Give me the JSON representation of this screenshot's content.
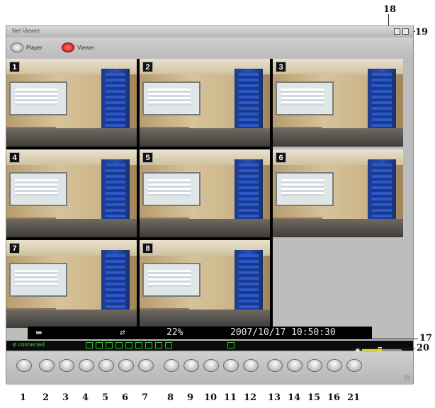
{
  "window": {
    "title": "Net Viewer",
    "modes": [
      {
        "label": "Player",
        "icon": "player-icon"
      },
      {
        "label": "Viewer",
        "icon": "viewer-icon"
      }
    ],
    "controls": [
      {
        "icon": "minimize-icon"
      },
      {
        "icon": "close-icon"
      }
    ]
  },
  "cameras": [
    {
      "number": "1"
    },
    {
      "number": "2"
    },
    {
      "number": "3"
    },
    {
      "number": "4"
    },
    {
      "number": "5"
    },
    {
      "number": "6"
    },
    {
      "number": "7"
    },
    {
      "number": "8"
    }
  ],
  "status_row": {
    "cpu": "22%",
    "datetime": "2007/10/17  10:50:30"
  },
  "info_bar": {
    "connection": "connected",
    "channel_count": 9,
    "volume_level": 0.45
  },
  "toolbar": {
    "buttons": [
      {
        "icon": "button-1-icon"
      },
      {
        "icon": "button-2-icon"
      },
      {
        "icon": "button-3-icon"
      },
      {
        "icon": "button-4-icon"
      },
      {
        "icon": "button-5-icon"
      },
      {
        "icon": "button-6-icon"
      },
      {
        "icon": "button-7-icon"
      },
      {
        "icon": "button-8-icon"
      },
      {
        "icon": "button-9-icon"
      },
      {
        "icon": "button-10-icon"
      },
      {
        "icon": "button-11-icon"
      },
      {
        "icon": "button-12-icon"
      },
      {
        "icon": "button-13-icon"
      },
      {
        "icon": "button-14-icon"
      },
      {
        "icon": "button-15-icon"
      },
      {
        "icon": "button-16-icon"
      },
      {
        "icon": "button-21-icon"
      }
    ]
  },
  "callouts": {
    "labels": [
      "1",
      "2",
      "3",
      "4",
      "5",
      "6",
      "7",
      "8",
      "9",
      "10",
      "11",
      "12",
      "13",
      "14",
      "15",
      "16",
      "21"
    ],
    "c17": "17",
    "c18": "18",
    "c19": "19",
    "c20": "20"
  },
  "colors": {
    "connected": "#3ddc3d",
    "volume": "#e8e000"
  }
}
